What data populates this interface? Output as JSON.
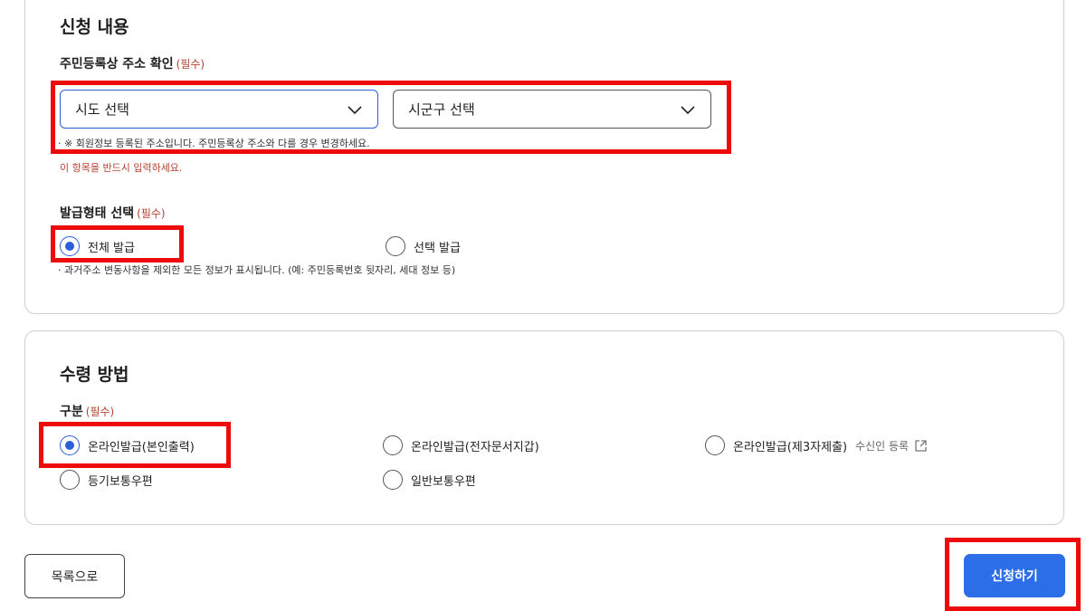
{
  "application": {
    "title": "신청 내용",
    "address": {
      "label": "주민등록상 주소 확인",
      "required": "(필수)",
      "sido_placeholder": "시도 선택",
      "sigungu_placeholder": "시군구 선택",
      "hint": "· ※ 회원정보 등록된 주소입니다. 주민등록상 주소와 다를 경우 변경하세요.",
      "error": "이 항목을 반드시 입력하세요."
    },
    "issue_type": {
      "label": "발급형태 선택",
      "required": "(필수)",
      "options": [
        "전체 발급",
        "선택 발급"
      ],
      "selected": "전체 발급",
      "hint": "· 과거주소 변동사항을 제외한 모든 정보가 표시됩니다. (예: 주민등록번호 뒷자리, 세대 정보 등)"
    }
  },
  "receipt": {
    "title": "수령 방법",
    "label": "구분",
    "required": "(필수)",
    "options": [
      "온라인발급(본인출력)",
      "온라인발급(전자문서지갑)",
      "온라인발급(제3자제출)",
      "등기보통우편",
      "일반보통우편"
    ],
    "selected": "온라인발급(본인출력)",
    "recipient_link": "수신인 등록"
  },
  "buttons": {
    "list": "목록으로",
    "apply": "신청하기"
  },
  "colors": {
    "accent": "#2b5fd9",
    "primary_button": "#2c6de8",
    "required_text": "#b3422f",
    "highlight": "#ee0a0a"
  },
  "icons": [
    "chevron-down-icon",
    "external-link-icon",
    "radio-icon"
  ]
}
